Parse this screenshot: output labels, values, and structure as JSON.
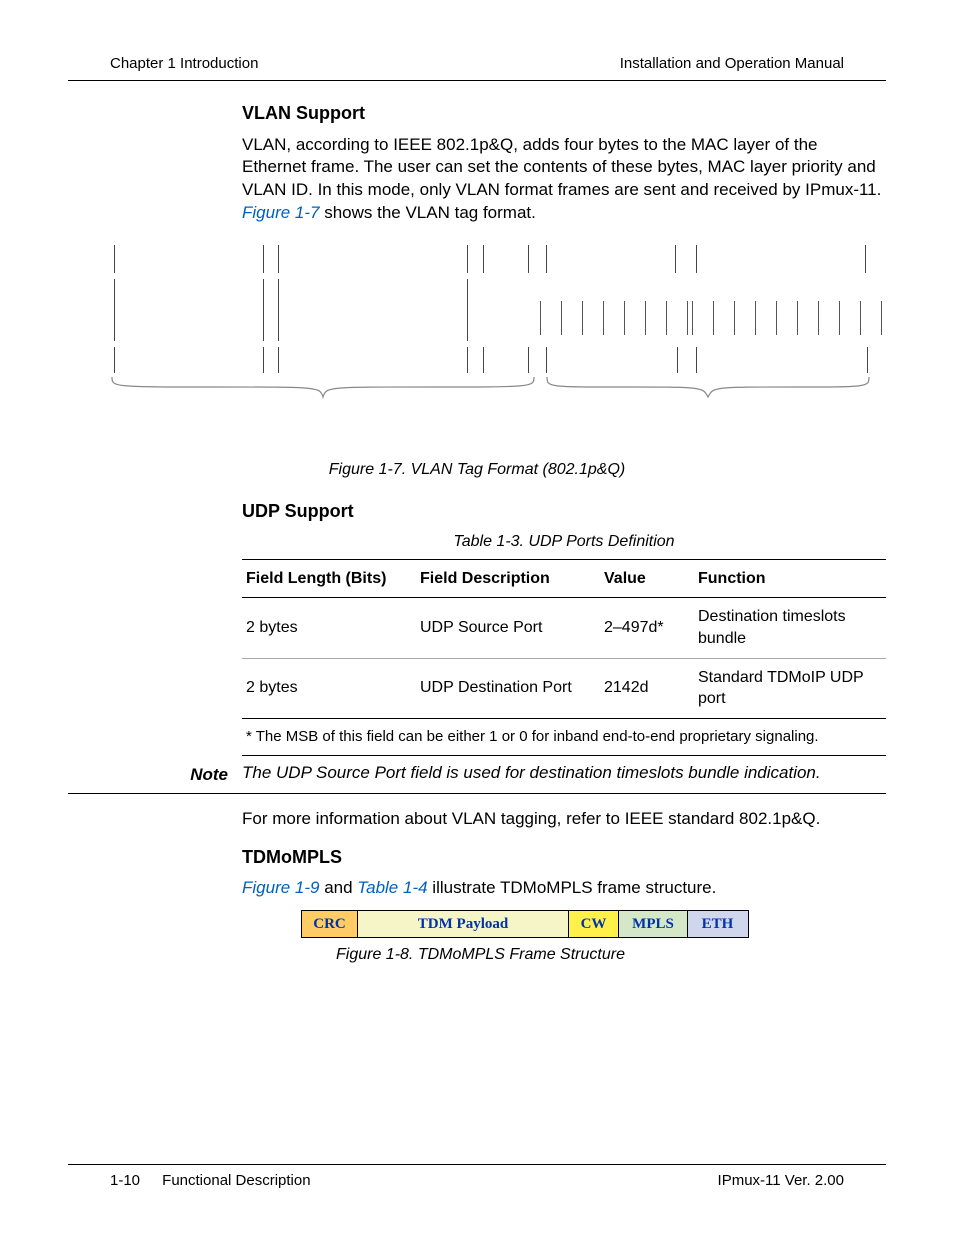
{
  "header": {
    "left": "Chapter 1 Introduction",
    "right": "Installation and Operation Manual"
  },
  "vlan": {
    "heading": "VLAN Support",
    "para_pre": "VLAN, according to IEEE 802.1p&Q, adds four bytes to the MAC layer of the Ethernet frame. The user can set the contents of these bytes, MAC layer priority and VLAN ID. In this mode, only VLAN format frames are sent and received by IPmux-11. ",
    "fig_link": "Figure 1-7",
    "para_post": " shows the VLAN tag format.",
    "caption": "Figure 1-7.  VLAN Tag Format (802.1p&Q)"
  },
  "udp": {
    "heading": "UDP Support",
    "caption": "Table 1-3.  UDP Ports Definition",
    "headers": [
      "Field Length (Bits)",
      "Field Description",
      "Value",
      "Function"
    ],
    "rows": [
      [
        "2 bytes",
        "UDP Source Port",
        "2–497d*",
        "Destination timeslots bundle"
      ],
      [
        "2 bytes",
        "UDP Destination Port",
        "2142d",
        "Standard TDMoIP UDP port"
      ]
    ],
    "footnote": "* The MSB of this field can be either 1 or 0 for inband end-to-end proprietary signaling.",
    "note_label": "Note",
    "note_text": "The UDP Source Port field is used for destination timeslots bundle indication.",
    "after_note": "For more information about VLAN tagging, refer to IEEE standard 802.1p&Q."
  },
  "tdm": {
    "heading": "TDMoMPLS",
    "link1": "Figure 1-9",
    "mid": " and ",
    "link2": "Table 1-4",
    "post": " illustrate TDMoMPLS frame structure.",
    "cells": {
      "crc": "CRC",
      "tdm": "TDM Payload",
      "cw": "CW",
      "mpls": "MPLS",
      "eth": "ETH"
    },
    "caption": "Figure 1-8.  TDMoMPLS Frame Structure"
  },
  "footer": {
    "page": "1-10",
    "section": "Functional Description",
    "product": "IPmux-11 Ver. 2.00"
  }
}
